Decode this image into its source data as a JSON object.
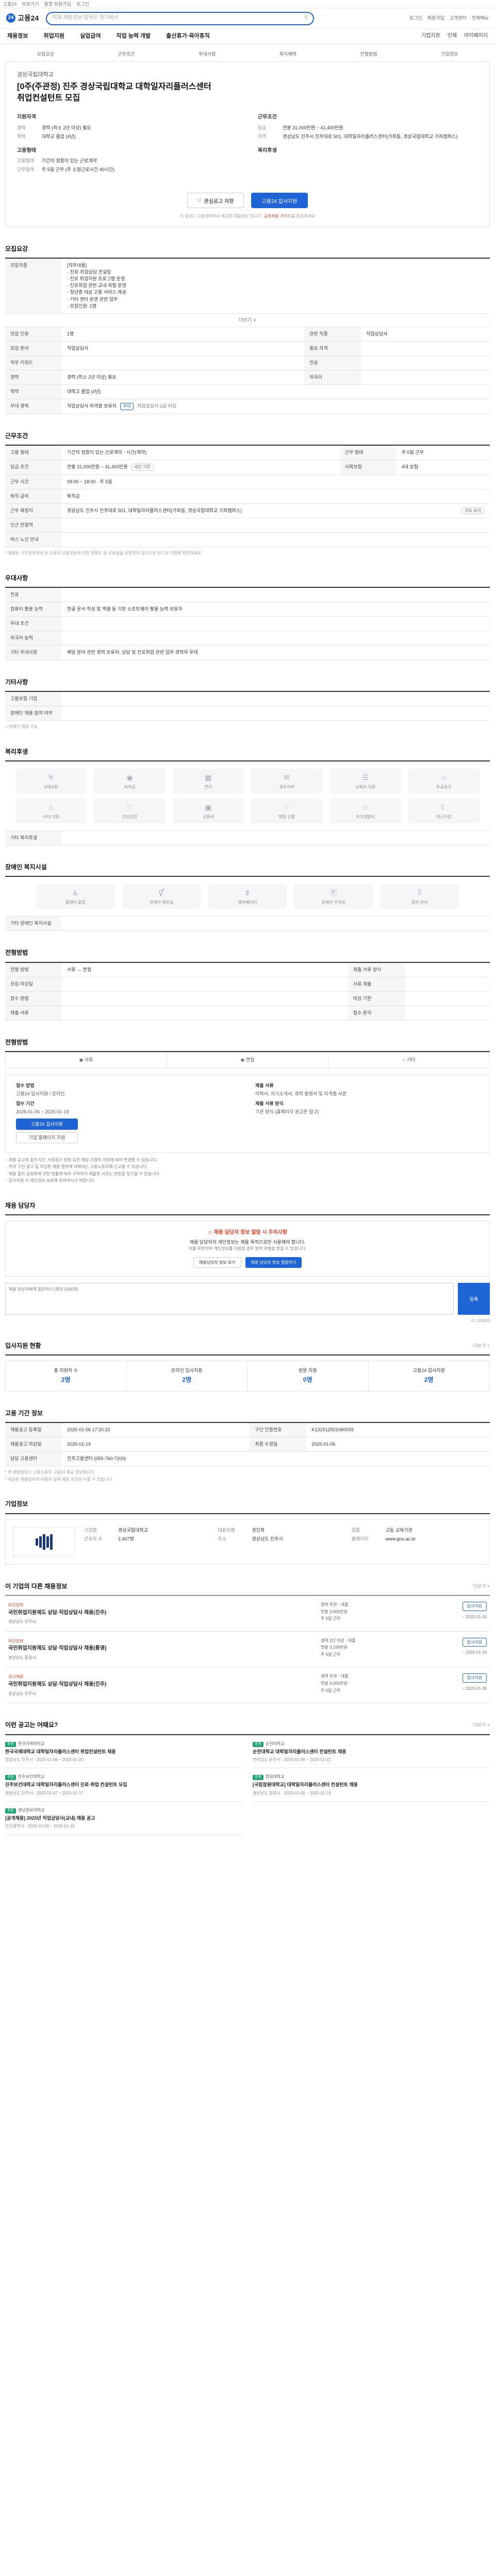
{
  "topbar": {
    "left": "고용24",
    "links": [
      "바로가기",
      "통합 회원가입",
      "로그인"
    ]
  },
  "header": {
    "logo_text": "고용24",
    "logo_mark": "24",
    "search_placeholder": "이제 채용정보 검색은 여기에서",
    "links": [
      "로그인",
      "회원가입",
      "고객센터",
      "전체메뉴"
    ]
  },
  "gnb": {
    "items": [
      "채용정보",
      "취업지원",
      "실업급여",
      "직업 능력 개발",
      "출산휴가·육아휴직"
    ],
    "right": [
      "기업지원",
      "인재",
      "마이페이지"
    ]
  },
  "job": {
    "tabs": [
      "모집요강",
      "근무조건",
      "우대사항",
      "복지혜택",
      "전형방법",
      "기업정보"
    ],
    "company": "경상국립대학교",
    "title": "[0주(주관정) 진주 경상국립대학교 대학일자리플러스센터 취업컨설턴트 모집",
    "summary": {
      "left_title": "지원자격",
      "left_rows": [
        {
          "k": "경력",
          "v": "경력 (최소 2년 이상) 필요"
        },
        {
          "k": "학력",
          "v": "대학교 졸업 (4년)"
        }
      ],
      "right_title": "근무조건",
      "right_rows": [
        {
          "k": "임금",
          "v": "연봉 31,000만원 ~ 41,400만원"
        },
        {
          "k": "지역",
          "v": "경상남도 진주시 진주대로 501, 대학일자리플러스센터(가좌동, 경상국립대학교 가좌캠퍼스)"
        }
      ],
      "left2_title": "고용형태",
      "left2_rows": [
        {
          "k": "고용형태",
          "v": "기간의 정함이 있는 근로계약"
        },
        {
          "k": "근무형태",
          "v": "주 5일 근무 (주 소정근로시간 40시간)"
        }
      ],
      "right2_title": "복리후생",
      "right2_rows": []
    },
    "actions": {
      "save": "관심공고 저장",
      "apply": "고용24 입사지원"
    },
    "note_prefix": "이 정보는 고용센터에서 제공한 채용정보 입니다.",
    "note_red": "공정채용 가이드",
    "note_suffix": "를 참조하세요"
  },
  "recruit": {
    "title": "모집요강",
    "job_desc_label": "모집직종",
    "job_desc": "[직무내용]\n· 진로·취업상담 컨설팅\n· 진로 취업지원 프로그램 운영\n· 진로취업 관련 교내 외협 운영\n· 청년층 대상 고용 서비스 제공\n· 기타 센터 운영 관련 업무\n· 모집인원: 1명",
    "more_link": "더보기 ∨",
    "rows": [
      {
        "k": "모집 인원",
        "v": "1명"
      },
      {
        "k": "모집 분야",
        "v": "직업상담사"
      },
      {
        "k": "직무 키워드",
        "v": ""
      },
      {
        "k": "경력",
        "v": "경력 (최소 2년 이상) 필요"
      },
      {
        "k": "학력",
        "v": "대학교 졸업 (4년)"
      },
      {
        "k": "우대 경력",
        "v": "직업상담사 자격증 보유자"
      },
      {
        "k": "",
        "v": ""
      }
    ],
    "right_rows": [
      {
        "k": "관련 직종",
        "v": "직업상담사"
      },
      {
        "k": "필요 자격",
        "v": ""
      },
      {
        "k": "전공",
        "v": ""
      },
      {
        "k": "외국어",
        "v": ""
      }
    ],
    "cert_chip": "우대",
    "cert_note": "직업상담사 2급 이상"
  },
  "conditions": {
    "title": "근무조건",
    "rows": [
      {
        "k": "고용 형태",
        "v": "기간의 정함이 있는 근로계약 · 시간(계약)"
      },
      {
        "k": "임금 조건",
        "v": "연봉 31,000만원 ~ 41,400만원"
      },
      {
        "k": "근무 시간",
        "v": "09:00 ~ 18:00 · 주 5일"
      },
      {
        "k": "퇴직 급여",
        "v": "퇴직금"
      },
      {
        "k": "근무 예정지",
        "v": "경상남도 진주시 진주대로 501, 대학일자리플러스센터(가좌동, 경상국립대학교 가좌캠퍼스)"
      },
      {
        "k": "인근 전철역",
        "v": ""
      },
      {
        "k": "버스 노선 안내",
        "v": ""
      }
    ],
    "side_rows": [
      {
        "k": "근무 형태",
        "v": "주 5일 근무"
      },
      {
        "k": "사회보험",
        "v": "4대 보험"
      }
    ],
    "wage_note": "세전 기준",
    "map_btn": "지도 보기",
    "foot_note": "* 제출된 구인정보에서 본 자료의 고용정보에 대한 정확도 및 신뢰성을 보장하지 않으므로 반드시 기업에 확인하세요."
  },
  "prefer": {
    "title": "우대사항",
    "rows": [
      {
        "k": "전공",
        "v": ""
      },
      {
        "k": "컴퓨터 활용 능력",
        "v": "한글 문서 작성 및 엑셀 등 기본 소프트웨어 활용 능력 보유자"
      },
      {
        "k": "우대 조건",
        "v": ""
      },
      {
        "k": "외국어 능력",
        "v": ""
      },
      {
        "k": "기타 우대사항",
        "v": "해당 분야 관련 경력 보유자, 상담 및 진로취업 관련 업무 경력자 우대"
      }
    ]
  },
  "other": {
    "title": "기타사항",
    "rows": [
      {
        "k": "고용보험 기업",
        "v": ""
      },
      {
        "k": "장애인 채용 참여 여부",
        "v": ""
      }
    ],
    "check_text": "□ 장애인 채용 가능"
  },
  "welfare": {
    "title": "복리후생",
    "items": [
      "4대보험",
      "퇴직금",
      "연차",
      "경조사비",
      "교육비 지원",
      "유급휴가",
      "식대 지원",
      "건강검진",
      "교통비",
      "명절 선물",
      "자기계발비",
      "야근수당"
    ],
    "extra_label": "기타 복리후생",
    "extra_value": ""
  },
  "disabled": {
    "title": "장애인 복지시설",
    "items": [
      "휠체어 출입",
      "장애인 화장실",
      "엘리베이터",
      "장애인 주차장",
      "점자 안내"
    ],
    "extra_label": "기타 장애인 복지시설",
    "extra_value": ""
  },
  "process": {
    "title": "전형방법",
    "rows": [
      {
        "k": "전형 방법",
        "v": "서류 → 면접"
      },
      {
        "k": "모집 마감일",
        "v": ""
      },
      {
        "k": "접수 방법",
        "v": ""
      },
      {
        "k": "제출 서류",
        "v": ""
      }
    ],
    "right_rows": [
      {
        "k": "제출 서류 양식",
        "v": ""
      },
      {
        "k": "서류 제출",
        "v": ""
      },
      {
        "k": "마감 기한",
        "v": ""
      },
      {
        "k": "접수 문의",
        "v": ""
      }
    ]
  },
  "apply": {
    "title": "전형방법",
    "radios": [
      "서류",
      "면접",
      "기타"
    ],
    "method_label": "접수 방법",
    "method_value": "고용24 입사지원 / 온라인",
    "date_label": "접수 기간",
    "date_value": "2025-01-06 ~ 2025-01-19",
    "btn_primary": "고용24 입사지원",
    "btn_sub": "기업 홈페이지 지원",
    "docs_label": "제출 서류",
    "docs_value": "이력서, 자기소개서, 경력 증명서 및 자격증 사본",
    "form_label": "제출 서류 양식",
    "form_value": "기관 양식 (홈페이지 공고문 참고)",
    "bullets": [
      "채용 공고의 접수기간, 서류접수 방법 등은 해당 기업의 사정에 따라 변경될 수 있습니다.",
      "허위 구인 광고 등 부당한 채용 행위에 대해서는 고용노동부에 신고할 수 있습니다.",
      "채용 절차 공정화에 관한 법률에 따라 구직자가 제출한 서류는 반환을 청구할 수 있습니다.",
      "입사지원 시 개인정보 보호에 유의하시기 바랍니다."
    ]
  },
  "contact": {
    "title": "채용 담당자",
    "warn": "채용 담당자 정보 열람 시 주의사항",
    "line1": "채용 담당자의 개인정보는 채용 목적으로만 사용해야 합니다.",
    "line2": "이를 위반하여 개인정보를 이용할 경우 법적 처벌을 받을 수 있습니다.",
    "btn1": "채용담당자 정보 보기",
    "btn2": "채용 담당자 정보 열람하기",
    "qna_placeholder": "채용 담당자에게 질문하기 (최대 1000자)",
    "qna_btn": "등록",
    "note_count": "0 / 1000자"
  },
  "status": {
    "title": "입사지원 현황",
    "more": "더보기 +",
    "items": [
      {
        "label": "총 지원자 수",
        "value": "2명"
      },
      {
        "label": "온라인 입사지원",
        "value": "2명"
      },
      {
        "label": "방문 지원",
        "value": "0명"
      },
      {
        "label": "고용24 입사지원",
        "value": "2명"
      }
    ]
  },
  "info": {
    "title": "고용 기간 정보",
    "rows": [
      {
        "k": "채용공고 등록일",
        "v": "2025-01-06 17:20:32"
      },
      {
        "k": "채용공고 마감일",
        "v": "2025-01-19"
      },
      {
        "k": "담당 고용센터",
        "v": "진주고용센터 (055-760-7200)"
      }
    ],
    "right_rows": [
      {
        "k": "구인 인증번호",
        "v": "K131512501060039"
      },
      {
        "k": "최종 수정일",
        "v": "2025-01-06"
      }
    ],
    "footnotes": [
      "* 본 채용정보는 고용노동부 고용24 제공 정보입니다.",
      "* 제공된 채용정보의 내용과 실제 채용 조건이 다를 수 있습니다."
    ]
  },
  "company": {
    "title": "기업정보",
    "rows": [
      {
        "k": "기업명",
        "v": "경상국립대학교"
      },
      {
        "k": "대표자명",
        "v": "권진회"
      },
      {
        "k": "업종",
        "v": "고등 교육기관"
      },
      {
        "k": "근로자 수",
        "v": "2,407명"
      },
      {
        "k": "주소",
        "v": "경상남도 진주시"
      },
      {
        "k": "홈페이지",
        "v": "www.gnu.ac.kr"
      }
    ]
  },
  "related": {
    "title": "이 기업의 다른 채용정보",
    "more": "더보기 +",
    "items": [
      {
        "tag": "마감임박",
        "title": "국민취업지원제도 상담·직업상담사 채용(진주)",
        "meta": "경상남도 진주시",
        "lines": [
          "경력 무관 · 대졸",
          "연봉 3,000만원",
          "주 5일 근무"
        ],
        "date": "~ 2025-01-19",
        "btn": "입사지원"
      },
      {
        "tag": "마감임박",
        "title": "국민취업지원제도 상담·직업상담사 채용(통영)",
        "meta": "경상남도 통영시",
        "lines": [
          "경력 2년 이상 · 대졸",
          "연봉 3,100만원",
          "주 5일 근무"
        ],
        "date": "~ 2025-01-19",
        "btn": "입사지원"
      },
      {
        "tag": "상시채용",
        "title": "국민취업지원제도 상담·직업상담사 채용(진주)",
        "meta": "경상남도 진주시",
        "lines": [
          "경력 무관 · 대졸",
          "연봉 3,000만원",
          "주 5일 근무"
        ],
        "date": "~ 2025-01-26",
        "btn": "입사지원"
      }
    ]
  },
  "recommend": {
    "title": "이런 공고는 어때요?",
    "more": "더보기 +",
    "items": [
      {
        "badge": "추천",
        "company": "한국국제대학교",
        "title": "한국국제대학교 대학일자리플러스센터 취업컨설턴트 채용",
        "meta": "경상남도 진주시 · 2025-01-06 ~ 2025-01-20"
      },
      {
        "badge": "추천",
        "company": "순천대학교",
        "title": "순천대학교 대학일자리플러스센터 컨설턴트 채용",
        "meta": "전라남도 순천시 · 2025-01-06 ~ 2025-01-22"
      },
      {
        "badge": "추천",
        "company": "진주보건대학교",
        "title": "진주보건대학교 대학일자리플러스센터 진로·취업 컨설턴트 모집",
        "meta": "경상남도 진주시 · 2025-01-07 ~ 2025-01-17"
      },
      {
        "badge": "추천",
        "company": "창원대학교",
        "title": "[국립창원대학교] 대학일자리플러스센터 컨설턴트 채용",
        "meta": "경상남도 창원시 · 2025-01-06 ~ 2025-01-19"
      },
      {
        "badge": "추천",
        "company": "경남정보대학교",
        "title": "[공개채용] 2025년 직업상담사(교내) 채용 공고",
        "meta": "부산광역시 · 2025-01-03 ~ 2025-01-15"
      }
    ]
  }
}
